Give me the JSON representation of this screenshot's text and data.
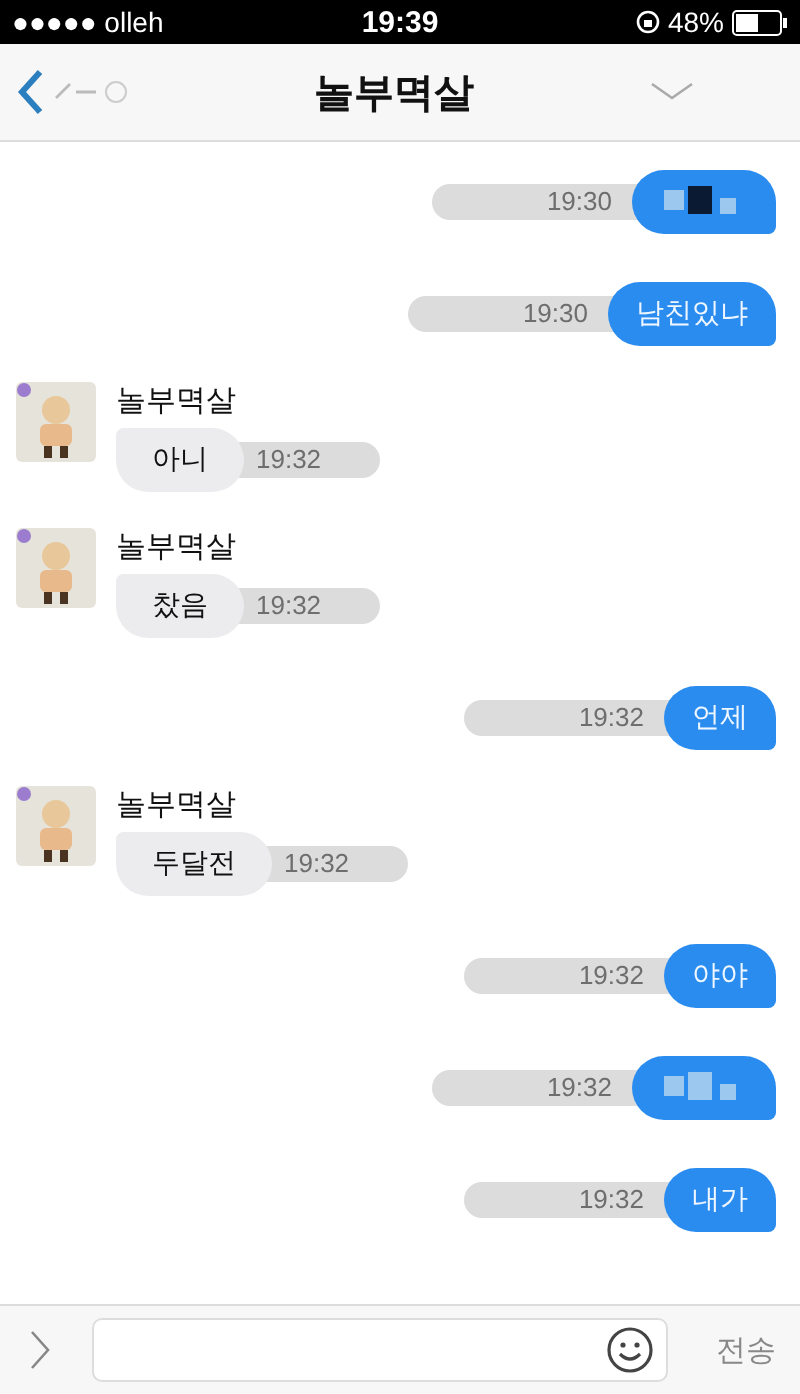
{
  "status_bar": {
    "carrier": "●●●●● olleh",
    "time": "19:39",
    "battery": "48%"
  },
  "nav": {
    "title": "놀부멱살",
    "back_label_redacted": true
  },
  "messages": [
    {
      "kind": "sent",
      "redacted": true,
      "time": "19:30"
    },
    {
      "kind": "sent",
      "text": "남친있냐",
      "redacted": false,
      "time": "19:30"
    },
    {
      "kind": "received",
      "sender": "놀부멱살",
      "text": "아니",
      "time": "19:32"
    },
    {
      "kind": "received",
      "sender": "놀부멱살",
      "text": "찼음",
      "time": "19:32"
    },
    {
      "kind": "sent",
      "text": "언제",
      "redacted": false,
      "time": "19:32"
    },
    {
      "kind": "received",
      "sender": "놀부멱살",
      "text": "두달전",
      "time": "19:32"
    },
    {
      "kind": "sent",
      "text": "야야",
      "redacted": false,
      "time": "19:32"
    },
    {
      "kind": "sent",
      "redacted": true,
      "time": "19:32"
    },
    {
      "kind": "sent",
      "text": "내가",
      "redacted": false,
      "time": "19:32"
    }
  ],
  "composer": {
    "send_label": "전송"
  }
}
